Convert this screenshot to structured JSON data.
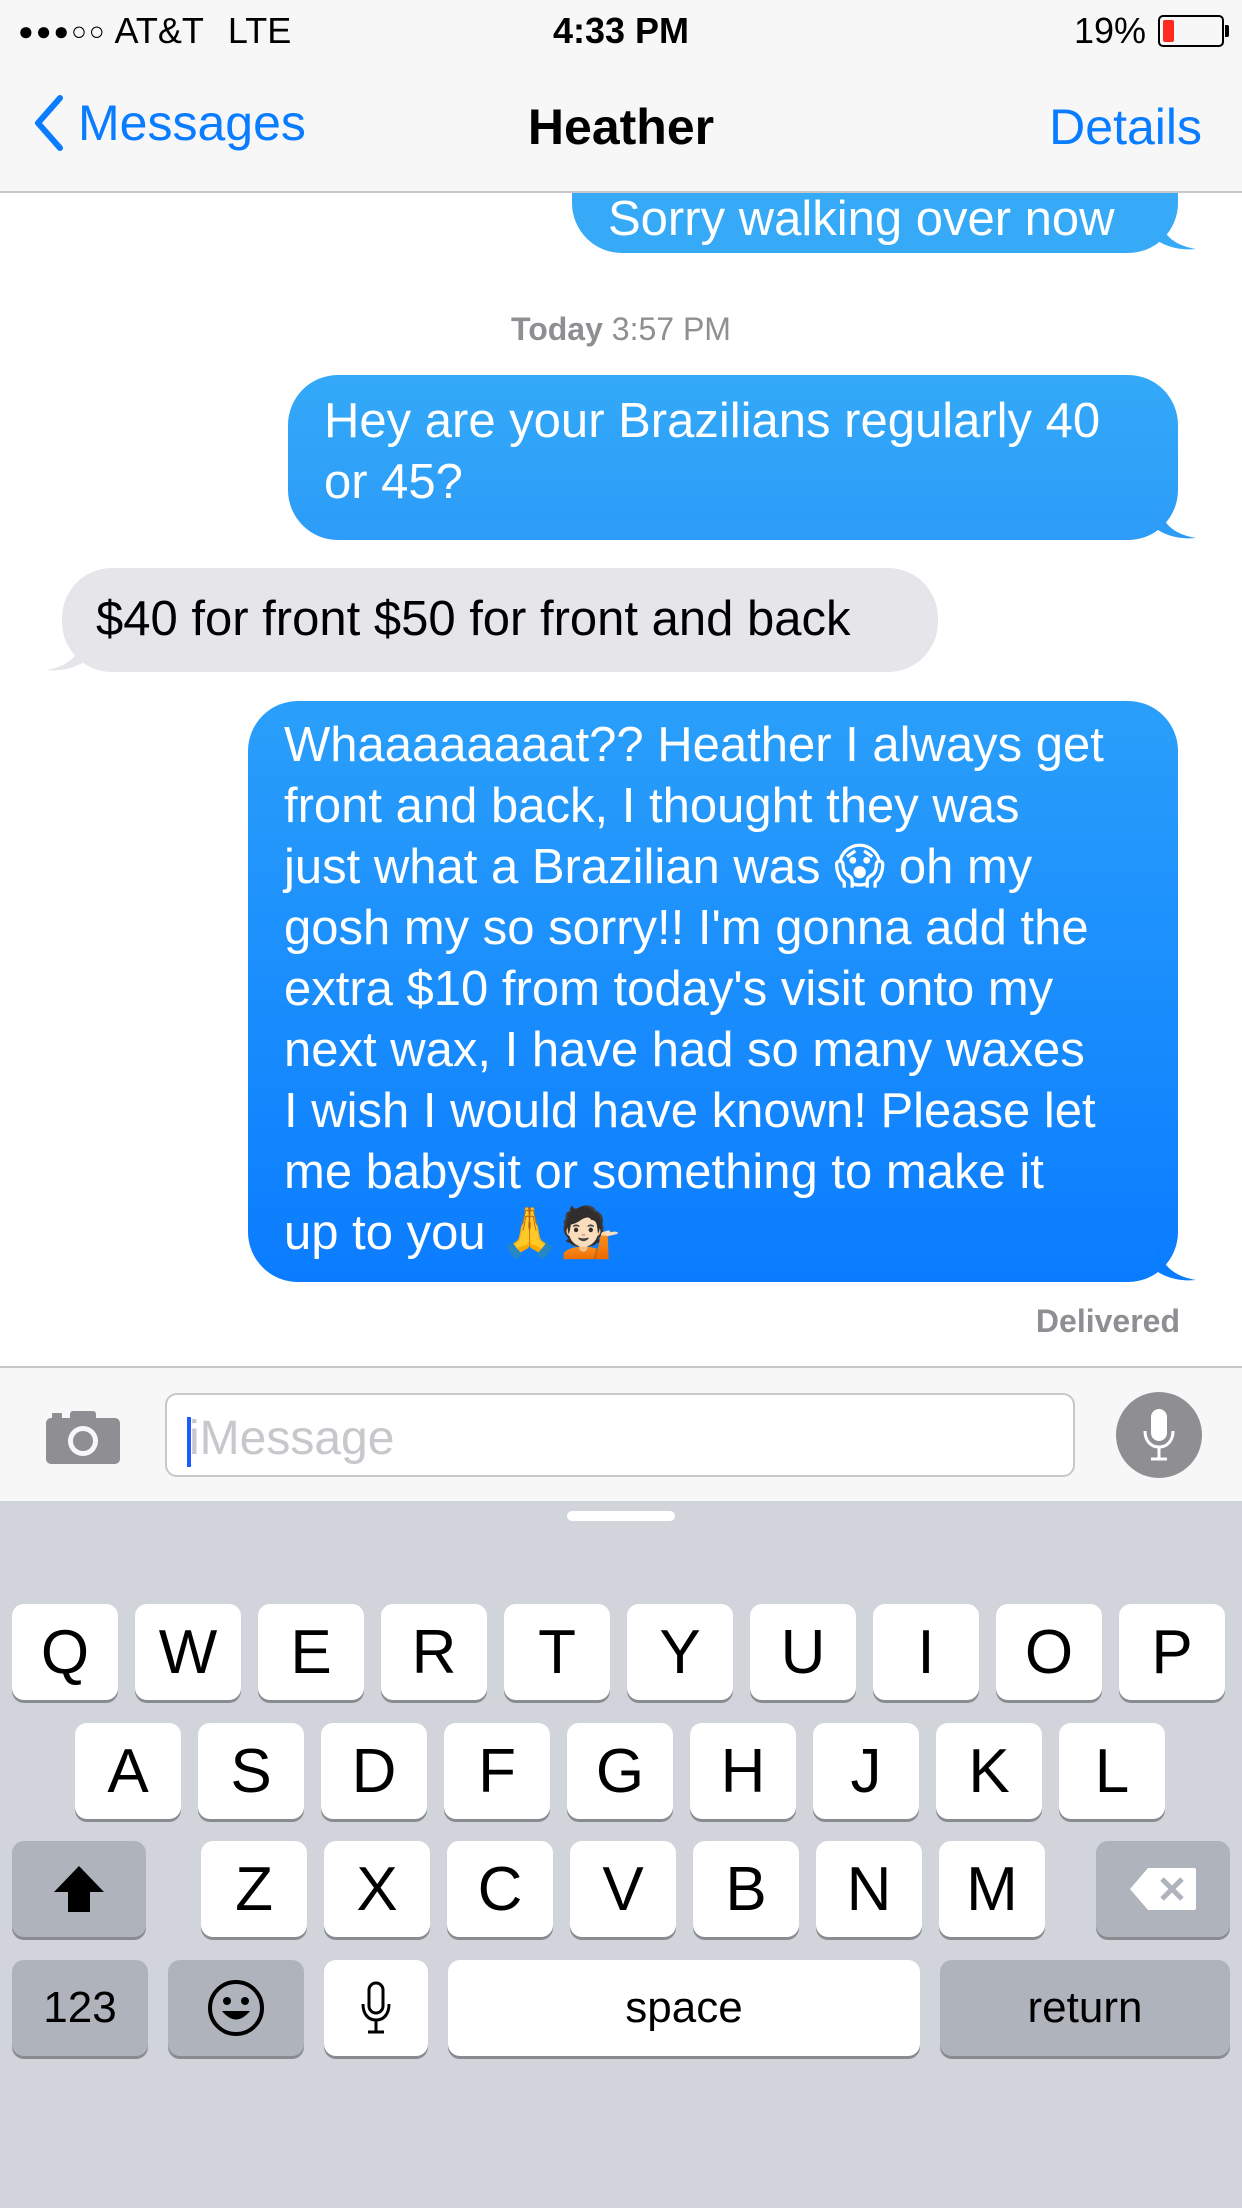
{
  "status_bar": {
    "signal": "●●●○○",
    "carrier": "AT&T",
    "network": "LTE",
    "time": "4:33 PM",
    "battery_percent": "19%",
    "battery_level": 0.19,
    "battery_color": "#ff2a1f"
  },
  "nav": {
    "back_label": "Messages",
    "title": "Heather",
    "details_label": "Details",
    "accent": "#0a7cff"
  },
  "messages": {
    "partial_top": "Sorry walking over now",
    "timestamp_day": "Today",
    "timestamp_time": "3:57 PM",
    "m1_line1": "Hey are your Brazilians regularly 40",
    "m1_line2": "or 45?",
    "m2": "$40 for front $50 for front and back",
    "m3_lines": [
      "Whaaaaaaaat?? Heather I always get",
      "front and back, I thought they was",
      "just what a Brazilian was 😱 oh my",
      "gosh my so sorry!! I'm gonna add the",
      "extra $10 from today's visit onto my",
      "next wax, I have had so many waxes",
      "I wish I would have known! Please let",
      "me babysit or something to make it",
      "up to you 🙏💁🏻"
    ],
    "delivered": "Delivered"
  },
  "input": {
    "placeholder": "iMessage",
    "camera_icon": "camera-icon",
    "mic_icon": "microphone-icon"
  },
  "keyboard": {
    "row1": [
      "Q",
      "W",
      "E",
      "R",
      "T",
      "Y",
      "U",
      "I",
      "O",
      "P"
    ],
    "row2": [
      "A",
      "S",
      "D",
      "F",
      "G",
      "H",
      "J",
      "K",
      "L"
    ],
    "row3": [
      "Z",
      "X",
      "C",
      "V",
      "B",
      "N",
      "M"
    ],
    "numbers_label": "123",
    "space_label": "space",
    "return_label": "return",
    "shift_icon": "shift-arrow-icon",
    "delete_icon": "backspace-icon",
    "emoji_icon": "emoji-smiley-icon",
    "dictation_icon": "microphone-icon"
  }
}
